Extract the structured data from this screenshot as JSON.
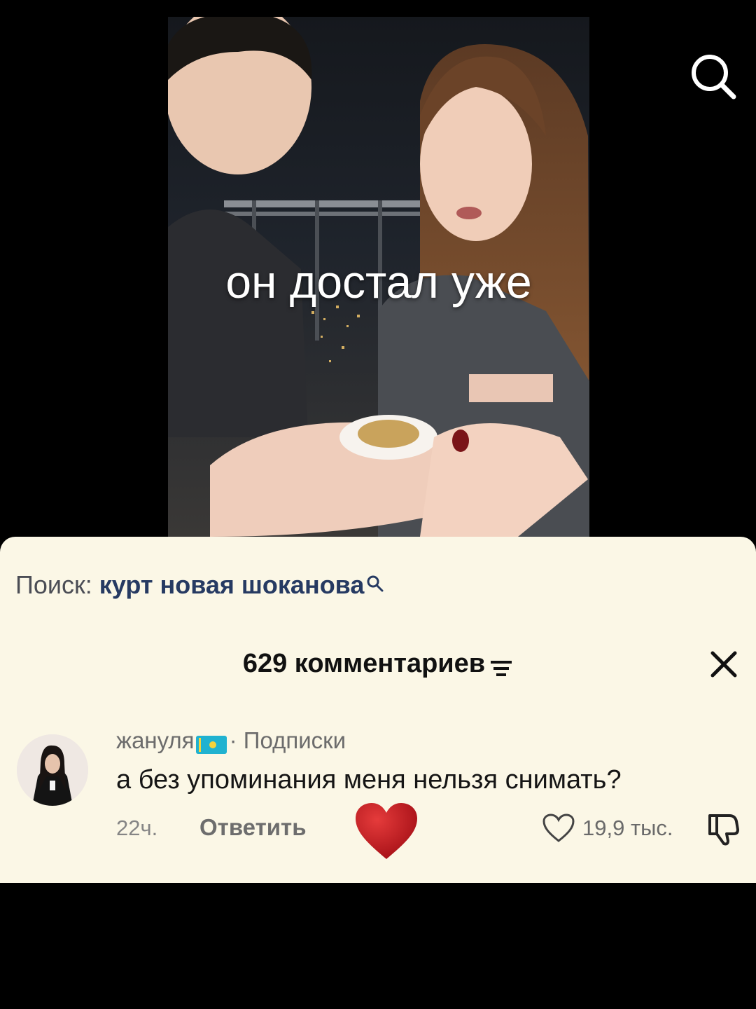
{
  "video": {
    "caption": "он достал уже"
  },
  "top_bar": {
    "search_icon": "search-icon"
  },
  "search_suggestion": {
    "label": "Поиск:",
    "query": "курт новая шоканова",
    "icon": "search-icon"
  },
  "comments": {
    "header": "629 комментариев",
    "sort_icon": "filter-icon",
    "close_icon": "close-icon",
    "items": [
      {
        "username": "жануля",
        "flag": "kazakhstan-flag-icon",
        "relation": "· Подписки",
        "text": "а без упоминания меня нельзя снимать?",
        "time": "22ч.",
        "reply_label": "Ответить",
        "creator_liked_icon": "heart-filled-icon",
        "likes": "19,9 тыс.",
        "like_icon": "heart-outline-icon",
        "dislike_icon": "thumbs-down-icon"
      }
    ]
  },
  "colors": {
    "sheet_bg": "#fbf7e6",
    "query": "#263a62",
    "heart": "#c1121f",
    "flag": "#20b2d0"
  }
}
